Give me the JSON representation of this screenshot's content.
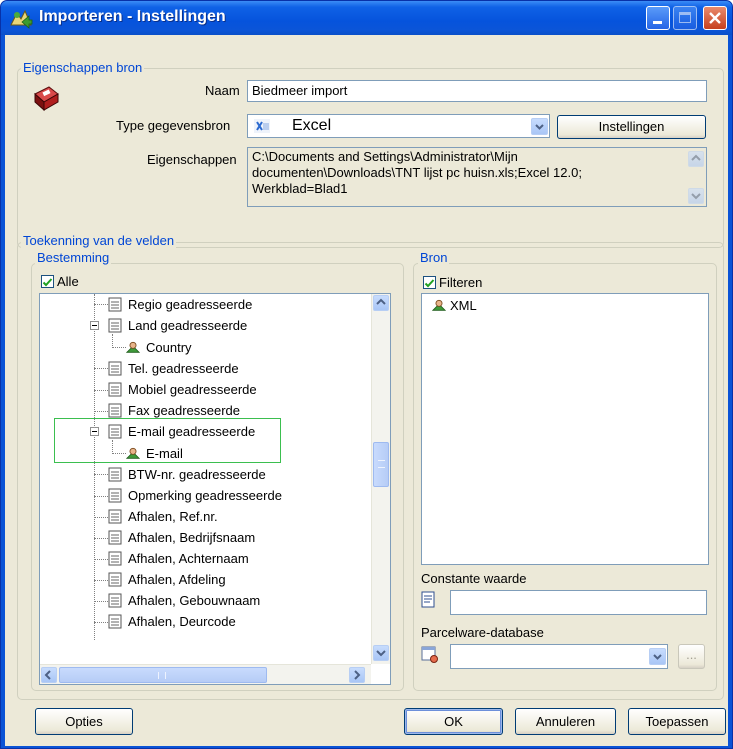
{
  "window": {
    "title": "Importeren - Instellingen"
  },
  "source_props": {
    "group_title": "Eigenschappen bron",
    "name_label": "Naam",
    "name_value": "Biedmeer import",
    "type_label": "Type gegevensbron",
    "type_value": "Excel",
    "settings_button": "Instellingen",
    "props_label": "Eigenschappen",
    "props_lines": [
      "C:\\Documents and Settings\\Administrator\\Mijn",
      "documenten\\Downloads\\TNT lijst pc huisn.xls;Excel 12.0;",
      "Werkblad=Blad1"
    ]
  },
  "mapping": {
    "group_title": "Toekenning van de velden",
    "destination": {
      "group_title": "Bestemming",
      "all_label": "Alle",
      "all_checked": true,
      "items": [
        {
          "label": "Regio geadresseerde"
        },
        {
          "label": "Land geadresseerde"
        },
        {
          "label": "Country"
        },
        {
          "label": "Tel. geadresseerde"
        },
        {
          "label": "Mobiel geadresseerde"
        },
        {
          "label": "Fax geadresseerde"
        },
        {
          "label": "E-mail geadresseerde"
        },
        {
          "label": "E-mail"
        },
        {
          "label": "BTW-nr. geadresseerde"
        },
        {
          "label": "Opmerking geadresseerde"
        },
        {
          "label": "Afhalen, Ref.nr."
        },
        {
          "label": "Afhalen, Bedrijfsnaam"
        },
        {
          "label": "Afhalen, Achternaam"
        },
        {
          "label": "Afhalen, Afdeling"
        },
        {
          "label": "Afhalen, Gebouwnaam"
        },
        {
          "label": "Afhalen, Deurcode"
        }
      ]
    },
    "source": {
      "group_title": "Bron",
      "filter_label": "Filteren",
      "filter_checked": true,
      "items": [
        {
          "label": "XML"
        }
      ],
      "constant_label": "Constante waarde",
      "constant_value": "",
      "database_label": "Parcelware-database",
      "database_value": "",
      "ellipsis_button": "..."
    }
  },
  "footer": {
    "options_button": "Opties",
    "ok_button": "OK",
    "cancel_button": "Annuleren",
    "apply_button": "Toepassen"
  }
}
